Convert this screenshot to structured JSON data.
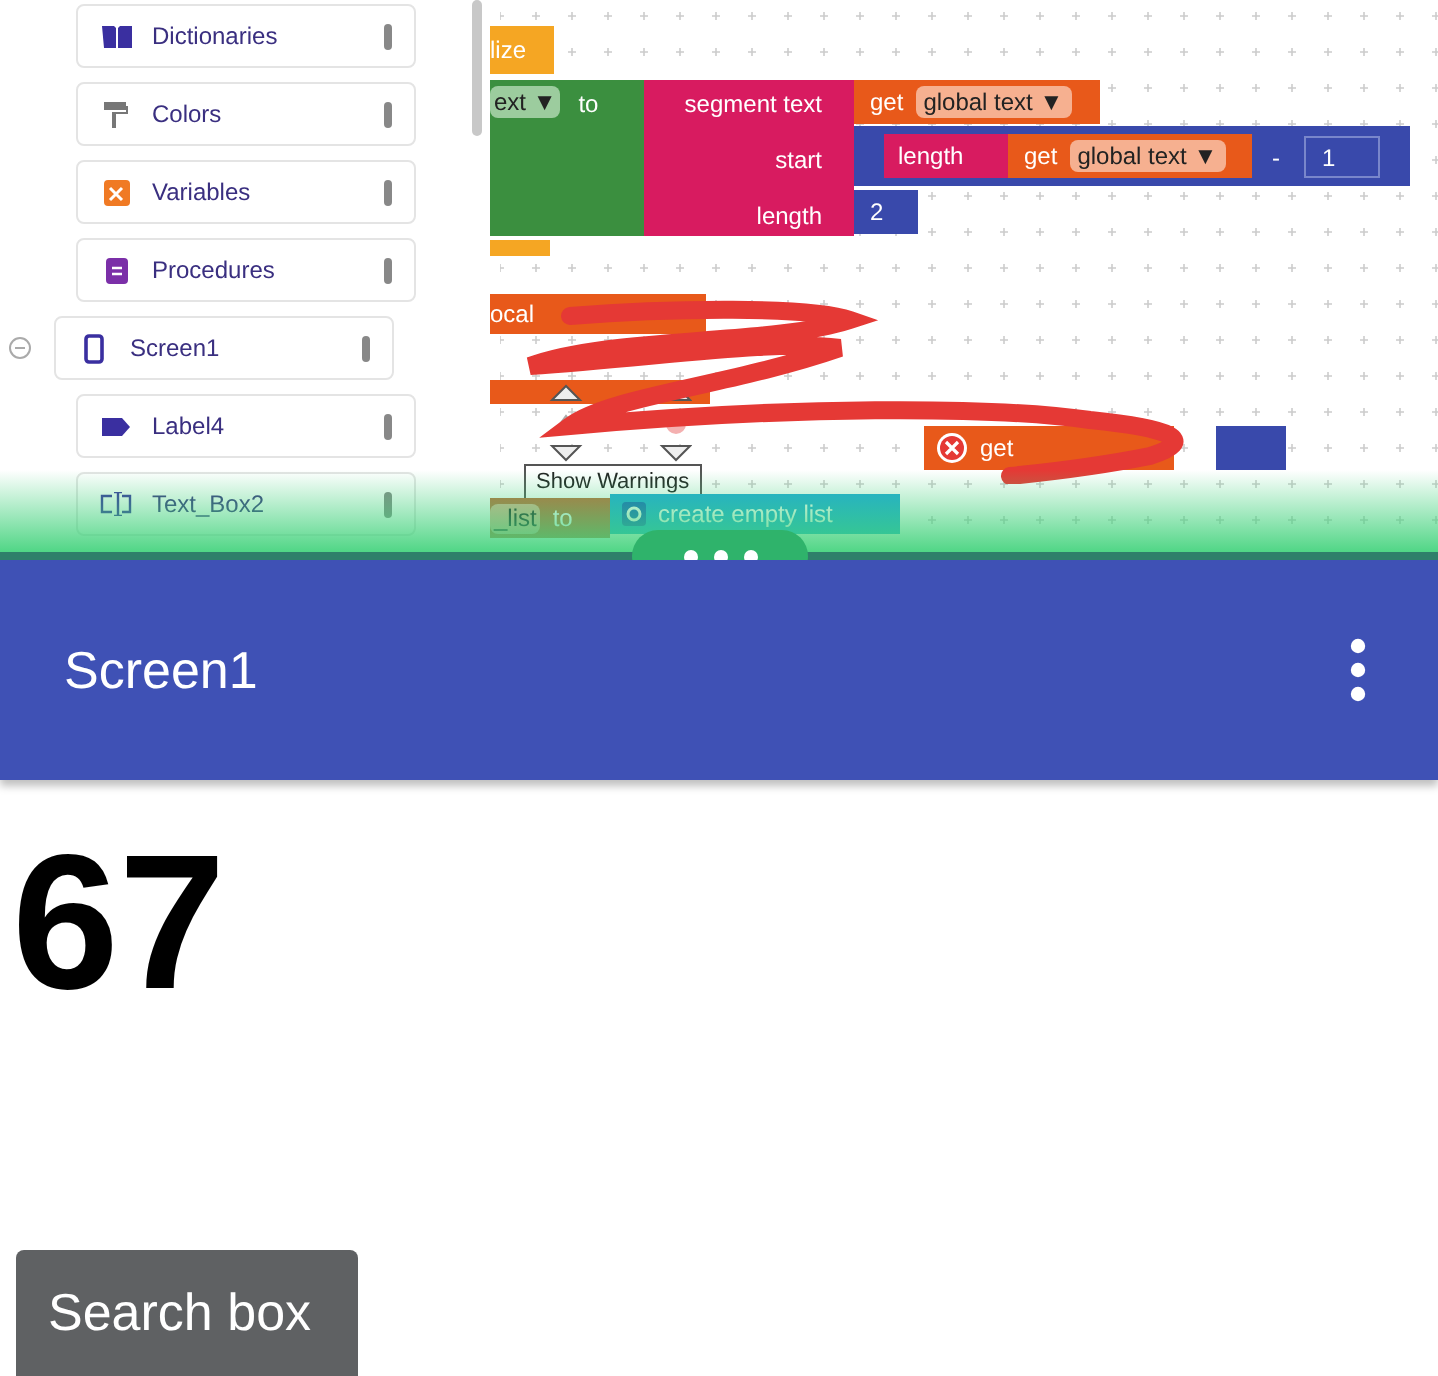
{
  "sidebar": {
    "builtins": [
      {
        "label": "Dictionaries",
        "kind": "dictionary"
      },
      {
        "label": "Colors",
        "kind": "colors"
      },
      {
        "label": "Variables",
        "kind": "variables"
      },
      {
        "label": "Procedures",
        "kind": "procedures"
      }
    ],
    "components": [
      {
        "label": "Screen1",
        "kind": "screen",
        "expanded": true,
        "children": [
          {
            "label": "Label4",
            "kind": "label"
          },
          {
            "label": "Text_Box2",
            "kind": "textbox"
          }
        ]
      }
    ]
  },
  "blocks": {
    "init_tail": "lize",
    "var_name": "ext ▼",
    "to": "to",
    "segment": "segment text",
    "start": "start",
    "length_label": "length",
    "get1": "get",
    "global1": "global text ▼",
    "length_fn": "length",
    "get2": "get",
    "global2": "global text ▼",
    "minus": "-",
    "one": "1",
    "two": "2",
    "local": "ocal",
    "warnings_tooltip": "Show Warnings",
    "get3": "get",
    "list_name": "_list",
    "to2": "to",
    "create": "create empty list"
  },
  "app": {
    "title": "Screen1",
    "number": "67",
    "button": "Search box"
  }
}
